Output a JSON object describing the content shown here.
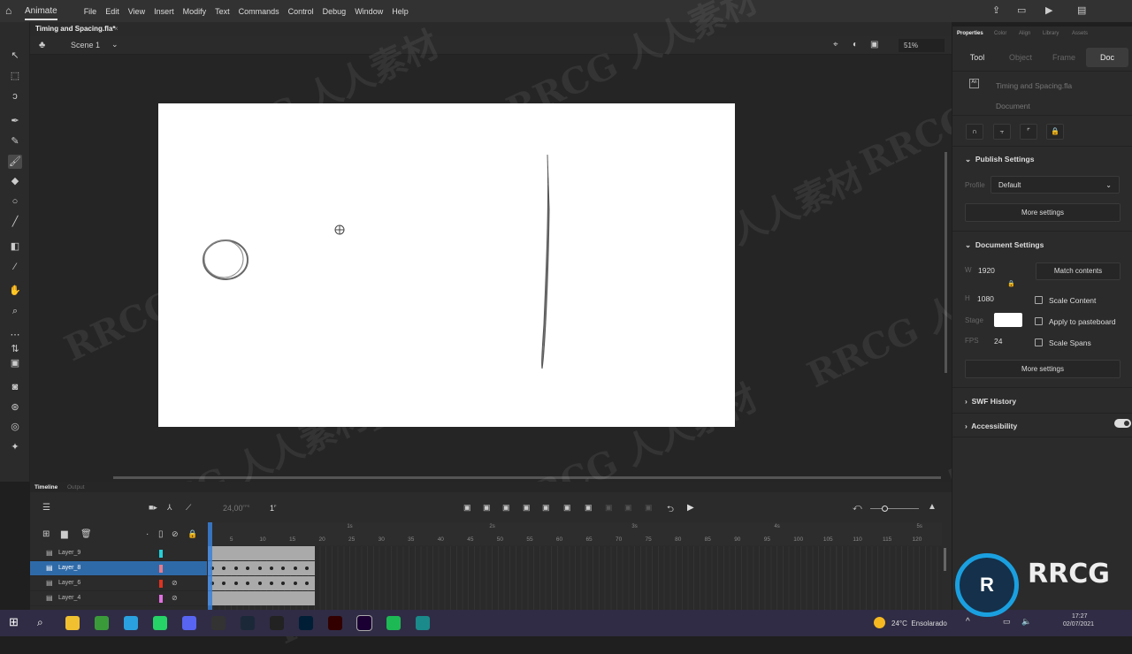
{
  "app": {
    "name": "Animate",
    "menu": [
      "File",
      "Edit",
      "View",
      "Insert",
      "Modify",
      "Text",
      "Commands",
      "Control",
      "Debug",
      "Window",
      "Help"
    ]
  },
  "document_tab": "Timing and Spacing.fla*",
  "scene": {
    "name": "Scene 1",
    "zoom": "51%"
  },
  "properties": {
    "tabs": [
      "Properties",
      "Color",
      "Align",
      "Library",
      "Assets"
    ],
    "segments": [
      "Tool",
      "Object",
      "Frame",
      "Doc"
    ],
    "active_segment": "Doc",
    "file_name": "Timing and Spacing.fla",
    "file_type": "Document",
    "publish": {
      "title": "Publish Settings",
      "profile_label": "Profile",
      "profile": "Default",
      "more": "More settings"
    },
    "doc_settings": {
      "title": "Document Settings",
      "w_label": "W",
      "w": "1920",
      "h_label": "H",
      "h": "1080",
      "match": "Match contents",
      "scale_content": "Scale Content",
      "apply_pasteboard": "Apply to pasteboard",
      "scale_spans": "Scale Spans",
      "stage_label": "Stage",
      "stage_color": "#ffffff",
      "fps_label": "FPS",
      "fps": "24",
      "more": "More settings"
    },
    "swf_history": "SWF History",
    "accessibility": "Accessibility"
  },
  "timeline": {
    "tabs": [
      "Timeline",
      "Output"
    ],
    "fps": "24,00",
    "fps_unit": "FPS",
    "frame": "1",
    "frame_unit": "F",
    "ruler": [
      "5",
      "10",
      "15",
      "20",
      "25",
      "30",
      "35",
      "40",
      "45",
      "50",
      "55",
      "60",
      "65",
      "70",
      "75",
      "80",
      "85",
      "90",
      "95",
      "100",
      "105",
      "110",
      "115",
      "120"
    ],
    "seconds": [
      "1s",
      "2s",
      "3s",
      "4s",
      "5s"
    ],
    "layers": [
      {
        "name": "Layer_9",
        "color": "#22d0d8",
        "hidden": false,
        "selected": false
      },
      {
        "name": "Layer_8",
        "color": "#e87a8a",
        "hidden": false,
        "selected": true
      },
      {
        "name": "Layer_6",
        "color": "#e0321e",
        "hidden": true,
        "selected": false
      },
      {
        "name": "Layer_4",
        "color": "#e070e0",
        "hidden": true,
        "selected": false
      }
    ]
  },
  "taskbar": {
    "weather": "24°C  Ensolarado",
    "time": "17:27",
    "date": "02/07/2021"
  },
  "watermark": "RRCG 人人素材"
}
